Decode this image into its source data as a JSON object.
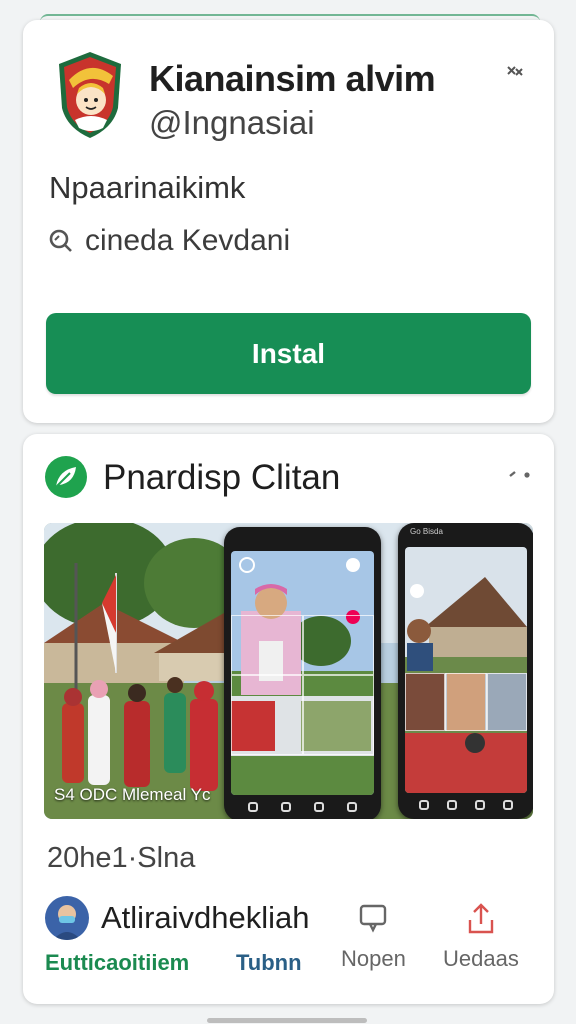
{
  "app_card": {
    "title": "Kianainsim alvim",
    "handle": "@Ingnasiai",
    "category": "Npaarinaikimk",
    "meta": "cineda Kevdani",
    "install_label": "Instal"
  },
  "feature_card": {
    "title": "Pnardisp Clitan",
    "media_caption": "S4 ODC Mlemeal Yc",
    "phone_label": "Go Bisda",
    "date": "20he1·Slna",
    "author_name": "Atliraivdhekliah",
    "actions": [
      {
        "label": "Eutticaoitiiem",
        "icon": "none"
      },
      {
        "label": "Tubnn",
        "icon": "none"
      },
      {
        "label": "Nopen",
        "icon": "comment-icon"
      },
      {
        "label": "Uedaas",
        "icon": "share-icon"
      }
    ]
  },
  "colors": {
    "install_green": "#178e55",
    "accent_green": "#1b8a50",
    "share_red": "#d9534f",
    "link_blue": "#2a5f86"
  }
}
